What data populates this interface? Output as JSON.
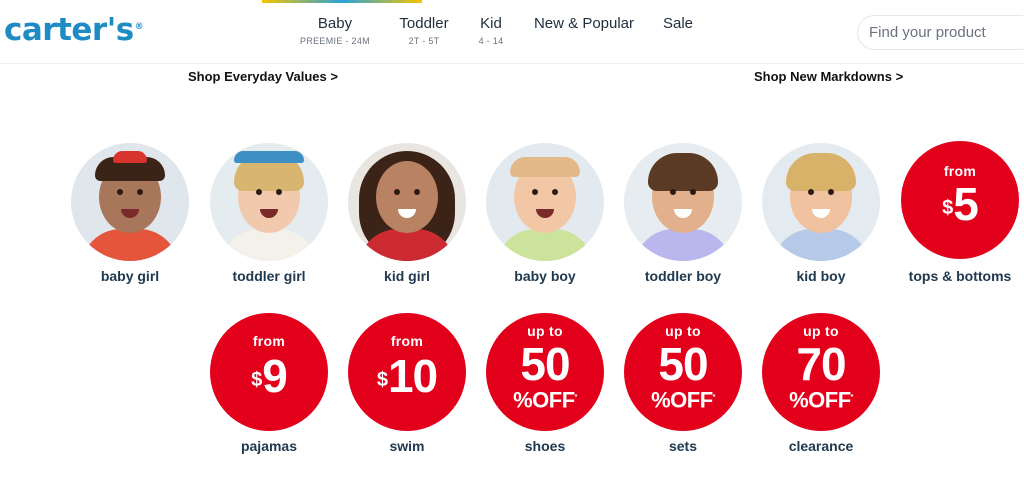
{
  "header": {
    "logo": "carter's",
    "logo_mark": "®",
    "nav": [
      {
        "label": "Baby",
        "sub": "PREEMIE - 24M"
      },
      {
        "label": "Toddler",
        "sub": "2T - 5T"
      },
      {
        "label": "Kid",
        "sub": "4 - 14"
      },
      {
        "label": "New & Popular",
        "sub": ""
      },
      {
        "label": "Sale",
        "sub": ""
      }
    ],
    "search_placeholder": "Find your product"
  },
  "promos": {
    "left": "Shop Everyday Values >",
    "right": "Shop New Markdowns >"
  },
  "categories": [
    {
      "label": "baby girl",
      "icon": "baby-girl-photo"
    },
    {
      "label": "toddler girl",
      "icon": "toddler-girl-photo"
    },
    {
      "label": "kid girl",
      "icon": "kid-girl-photo"
    },
    {
      "label": "baby boy",
      "icon": "baby-boy-photo"
    },
    {
      "label": "toddler boy",
      "icon": "toddler-boy-photo"
    },
    {
      "label": "kid boy",
      "icon": "kid-boy-photo"
    }
  ],
  "offers": [
    {
      "label": "tops & bottoms",
      "prefix": "from",
      "currency": "$",
      "amount": "5"
    },
    {
      "label": "pajamas",
      "prefix": "from",
      "currency": "$",
      "amount": "9"
    },
    {
      "label": "swim",
      "prefix": "from",
      "currency": "$",
      "amount": "10"
    },
    {
      "label": "shoes",
      "prefix": "up to",
      "amount": "50",
      "suffix": "%OFF",
      "mark": "*"
    },
    {
      "label": "sets",
      "prefix": "up to",
      "amount": "50",
      "suffix": "%OFF",
      "mark": "*"
    },
    {
      "label": "clearance",
      "prefix": "up to",
      "amount": "70",
      "suffix": "%OFF",
      "mark": "*"
    }
  ],
  "colors": {
    "brand": "#1e8bc3",
    "offer_red": "#e3001b",
    "label_navy": "#20394f"
  }
}
